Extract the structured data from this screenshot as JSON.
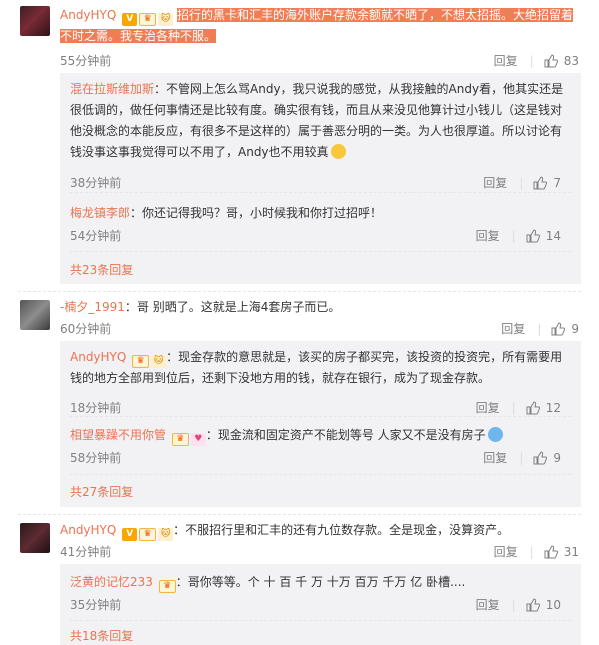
{
  "thread1": {
    "user": "AndyHYQ",
    "text_highlighted": "招行的黑卡和汇丰的海外账户存款余额就不晒了，不想太招摇。大绝招留着不时之需。我专治各种不服。",
    "time": "55分钟前",
    "reply_label": "回复",
    "likes": "83",
    "subs": [
      {
        "user": "混在拉斯维加斯",
        "text": "：不管网上怎么骂Andy，我只说我的感觉，从我接触的Andy看，他其实还是很低调的，做任何事情还是比较有度。确实很有钱，而且从来没见他算计过小钱儿（这是钱对他没概念的本能反应，有很多不是这样的）属于善恶分明的一类。为人也很厚道。所以讨论有钱没事这事我觉得可以不用了，Andy也不用较真",
        "time": "38分钟前",
        "reply_label": "回复",
        "likes": "7"
      },
      {
        "user": "梅龙镇李郎",
        "text": "：你还记得我吗？哥，小时候我和你打过招呼！",
        "time": "54分钟前",
        "reply_label": "回复",
        "likes": "14"
      }
    ],
    "more": "共23条回复"
  },
  "thread2": {
    "user": "-楠夕_1991",
    "text": "：哥 别晒了。这就是上海4套房子而已。",
    "time": "60分钟前",
    "reply_label": "回复",
    "likes": "9",
    "subs": [
      {
        "user": "AndyHYQ",
        "text": "：现金存款的意思就是，该买的房子都买完，该投资的投资完，所有需要用钱的地方全部用到位后，还剩下没地方用的钱，就存在银行，成为了现金存款。",
        "time": "18分钟前",
        "reply_label": "回复",
        "likes": "12"
      },
      {
        "user": "相望暴躁不用你管",
        "text": "：现金流和固定资产不能划等号  人家又不是没有房子",
        "time": "58分钟前",
        "reply_label": "回复",
        "likes": "9"
      }
    ],
    "more": "共27条回复"
  },
  "thread3": {
    "user": "AndyHYQ",
    "text": "：不服招行里和汇丰的还有九位数存款。全是现金，没算资产。",
    "time": "41分钟前",
    "reply_label": "回复",
    "likes": "31",
    "subs": [
      {
        "user": "泛黄的记忆233",
        "text": "：哥你等等。个 十 百 千 万 十万 百万 千万 亿  卧槽....",
        "time": "35分钟前",
        "reply_label": "回复",
        "likes": "10"
      }
    ],
    "more": "共18条回复"
  },
  "colors": {
    "username": "#eb7350",
    "highlight": "#f07d55",
    "muted": "#808080",
    "subbox": "#f2f2f5"
  },
  "icons": {
    "like": "thumbs-up-icon",
    "verified": "v-badge-icon",
    "crown": "crown-badge-icon",
    "cat": "cat-badge-icon"
  }
}
